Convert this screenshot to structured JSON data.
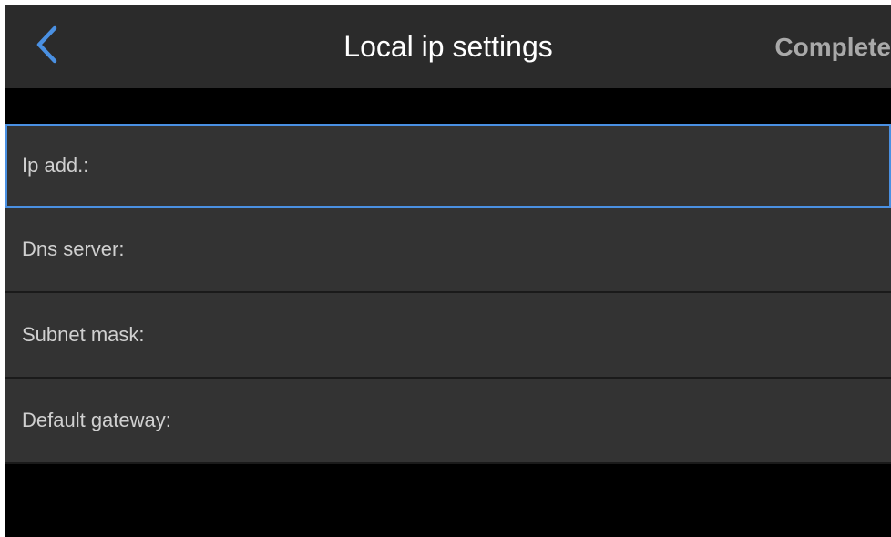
{
  "header": {
    "back_icon": "chevron-left-icon",
    "title": "Local ip settings",
    "complete_label": "Complete"
  },
  "fields": [
    {
      "label": "Ip add.:",
      "focused": true
    },
    {
      "label": "Dns server:",
      "focused": false
    },
    {
      "label": "Subnet mask:",
      "focused": false
    },
    {
      "label": "Default gateway:",
      "focused": false
    }
  ],
  "colors": {
    "header_bg": "#2b2b2b",
    "screen_bg": "#000000",
    "field_bg": "#333333",
    "accent": "#4a90e2",
    "complete_text": "#a9a9a9"
  }
}
